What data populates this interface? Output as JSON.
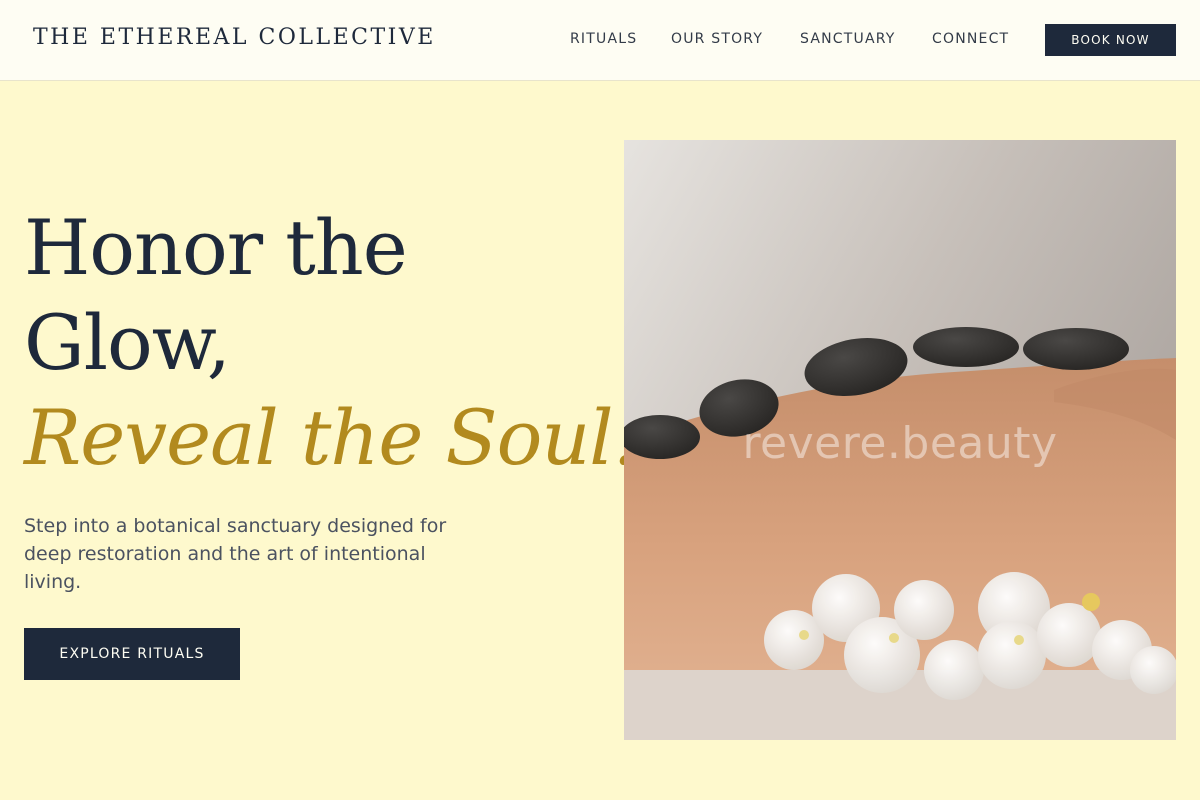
{
  "header": {
    "logo": "THE ETHEREAL COLLECTIVE",
    "nav": [
      "RITUALS",
      "OUR STORY",
      "SANCTUARY",
      "CONNECT"
    ],
    "cta": "BOOK NOW"
  },
  "hero": {
    "headline_line1": "Honor the",
    "headline_line2": "Glow,",
    "headline_accent": "Reveal the Soul.",
    "subtext": "Step into a botanical sanctuary designed for deep restoration and the art of intentional living.",
    "cta": "EXPLORE RITUALS",
    "image": {
      "subject": "hot stone massage with white orchids",
      "watermark": "revere.beauty"
    }
  },
  "colors": {
    "background": "#fef9cd",
    "header_bg": "#fefdf3",
    "navy": "#1e293b",
    "gold_accent": "#b28a1e"
  }
}
